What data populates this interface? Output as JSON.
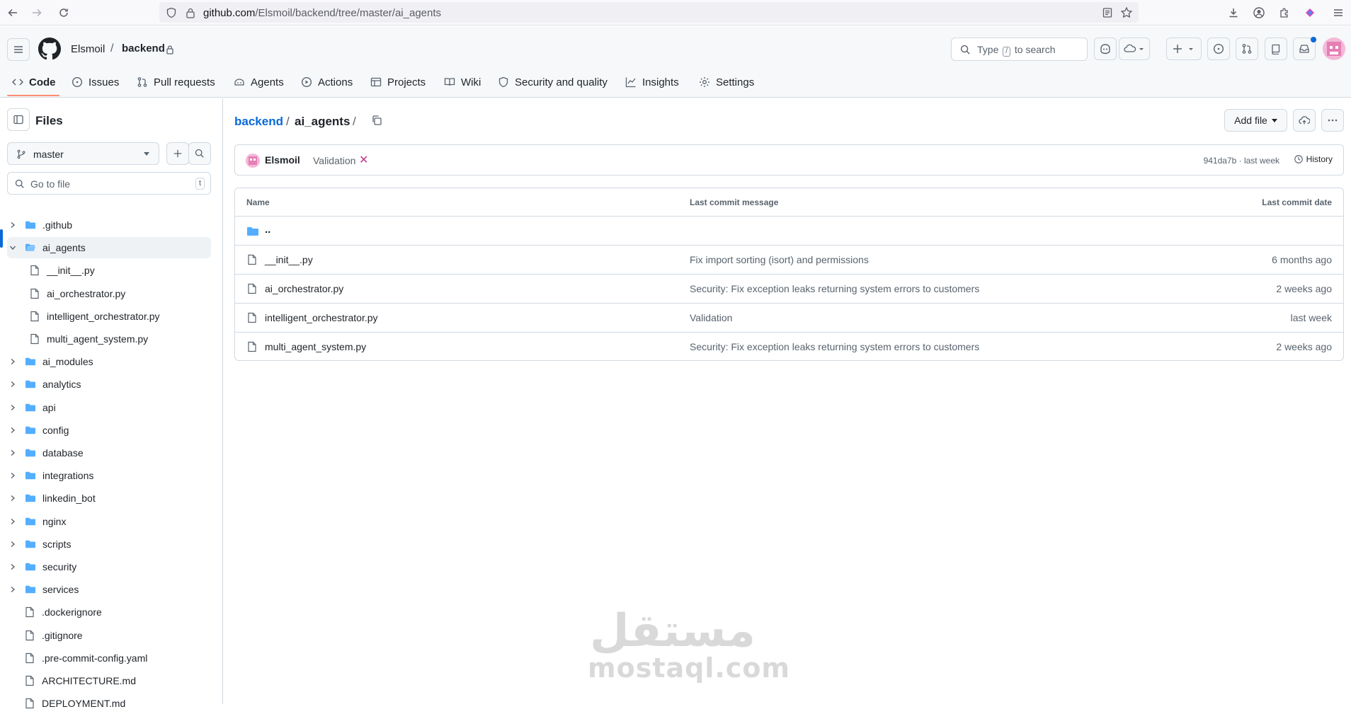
{
  "browser": {
    "url_host": "github.com",
    "url_path": "/Elsmoil/backend/tree/master/ai_agents"
  },
  "header": {
    "owner": "Elsmoil",
    "repo": "backend",
    "search": {
      "prefix": "Type",
      "key": "/",
      "suffix": "to search"
    }
  },
  "tabs": [
    {
      "label": "Code",
      "icon": "code-icon"
    },
    {
      "label": "Issues",
      "icon": "issue-opened-icon"
    },
    {
      "label": "Pull requests",
      "icon": "git-pull-request-icon"
    },
    {
      "label": "Agents",
      "icon": "agent-icon"
    },
    {
      "label": "Actions",
      "icon": "play-icon"
    },
    {
      "label": "Projects",
      "icon": "table-icon"
    },
    {
      "label": "Wiki",
      "icon": "book-icon"
    },
    {
      "label": "Security and quality",
      "icon": "shield-icon"
    },
    {
      "label": "Insights",
      "icon": "graph-icon"
    },
    {
      "label": "Settings",
      "icon": "gear-icon"
    }
  ],
  "sidebar": {
    "title": "Files",
    "branch": "master",
    "goto_placeholder": "Go to file",
    "goto_key": "t",
    "tree": [
      {
        "label": ".github",
        "type": "folder",
        "expanded": false
      },
      {
        "label": "ai_agents",
        "type": "folder",
        "expanded": true,
        "selected": true
      },
      {
        "label": "__init__.py",
        "type": "file",
        "child": true
      },
      {
        "label": "ai_orchestrator.py",
        "type": "file",
        "child": true
      },
      {
        "label": "intelligent_orchestrator.py",
        "type": "file",
        "child": true
      },
      {
        "label": "multi_agent_system.py",
        "type": "file",
        "child": true
      },
      {
        "label": "ai_modules",
        "type": "folder",
        "expanded": false
      },
      {
        "label": "analytics",
        "type": "folder",
        "expanded": false
      },
      {
        "label": "api",
        "type": "folder",
        "expanded": false
      },
      {
        "label": "config",
        "type": "folder",
        "expanded": false
      },
      {
        "label": "database",
        "type": "folder",
        "expanded": false
      },
      {
        "label": "integrations",
        "type": "folder",
        "expanded": false
      },
      {
        "label": "linkedin_bot",
        "type": "folder",
        "expanded": false
      },
      {
        "label": "nginx",
        "type": "folder",
        "expanded": false
      },
      {
        "label": "scripts",
        "type": "folder",
        "expanded": false
      },
      {
        "label": "security",
        "type": "folder",
        "expanded": false
      },
      {
        "label": "services",
        "type": "folder",
        "expanded": false
      },
      {
        "label": ".dockerignore",
        "type": "file"
      },
      {
        "label": ".gitignore",
        "type": "file"
      },
      {
        "label": ".pre-commit-config.yaml",
        "type": "file"
      },
      {
        "label": "ARCHITECTURE.md",
        "type": "file"
      },
      {
        "label": "DEPLOYMENT.md",
        "type": "file"
      }
    ]
  },
  "main": {
    "breadcrumb_repo": "backend",
    "breadcrumb_sep": "/",
    "breadcrumb_current": "ai_agents",
    "breadcrumb_trail": "/",
    "add_file_label": "Add file",
    "commit": {
      "author": "Elsmoil",
      "message": "Validation",
      "status": "✕",
      "sha": "941da7b",
      "separator": "·",
      "when": "last week",
      "history_label": "History"
    },
    "table": {
      "headers": [
        "Name",
        "Last commit message",
        "Last commit date"
      ],
      "parent_label": "..",
      "rows": [
        {
          "name": "__init__.py",
          "message": "Fix import sorting (isort) and permissions",
          "date": "6 months ago"
        },
        {
          "name": "ai_orchestrator.py",
          "message": "Security: Fix exception leaks returning system errors to customers",
          "date": "2 weeks ago"
        },
        {
          "name": "intelligent_orchestrator.py",
          "message": "Validation",
          "date": "last week"
        },
        {
          "name": "multi_agent_system.py",
          "message": "Security: Fix exception leaks returning system errors to customers",
          "date": "2 weeks ago"
        }
      ]
    }
  },
  "watermark": {
    "arabic": "مستقل",
    "latin": "mostaql.com"
  },
  "colors": {
    "link": "#0969da",
    "tab_underline": "#fd8c73",
    "failed": "#bf3989",
    "selected_bar": "#0969da"
  }
}
